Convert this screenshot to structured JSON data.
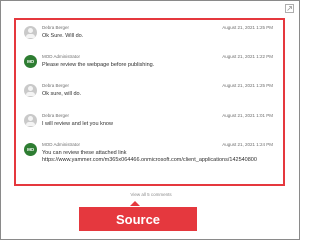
{
  "comments": [
    {
      "avatar_type": "user-icon",
      "author": "Debra Berger",
      "timestamp": "August 21, 2021 1:25 PM",
      "lines": [
        "Ok Sure. Will do."
      ]
    },
    {
      "avatar_type": "initials",
      "initials": "MO",
      "author": "MOD Administrator",
      "timestamp": "August 21, 2021 1:22 PM",
      "lines": [
        "Please review the webpage before publishing."
      ]
    },
    {
      "avatar_type": "user-icon",
      "author": "Debra Berger",
      "timestamp": "August 21, 2021 1:25 PM",
      "lines": [
        "Ok sure, will do."
      ]
    },
    {
      "avatar_type": "user-icon",
      "author": "Debra Berger",
      "timestamp": "August 21, 2021 1:01 PM",
      "lines": [
        "I will review and let you know"
      ]
    },
    {
      "avatar_type": "initials",
      "initials": "MO",
      "author": "MOD Administrator",
      "timestamp": "August 21, 2021 1:24 PM",
      "lines": [
        "You can review these attached link",
        "https://www.yammer.com/m365x064466.onmicrosoft.com/client_applications/142540800"
      ]
    }
  ],
  "view_all_text": "View all 5 comments",
  "source_label": "Source",
  "colors": {
    "highlight": "#e5383e",
    "initials_avatar": "#2e7d32"
  }
}
